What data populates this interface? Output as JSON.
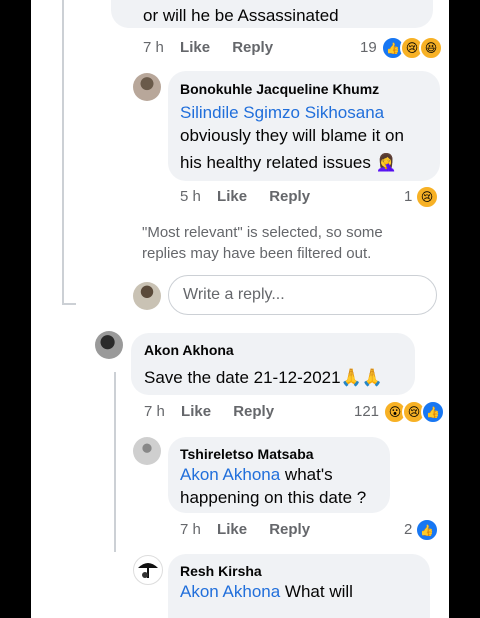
{
  "top_comment": {
    "partial_text": "or will he be Assassinated",
    "time": "7 h",
    "like_label": "Like",
    "reply_label": "Reply",
    "reaction_count": "19",
    "reactions": [
      "like-icon",
      "sad-icon",
      "haha-icon"
    ]
  },
  "reply1": {
    "author": "Bonokuhle Jacqueline Khumz",
    "mention": "Silindile Sgimzo Sikhosana",
    "line1": "obviously they will blame it on",
    "line2": "his healthy related issues",
    "emoji": "🤦‍♀️",
    "time": "5 h",
    "like_label": "Like",
    "reply_label": "Reply",
    "reaction_count": "1",
    "reactions": [
      "sad-icon"
    ]
  },
  "notice": {
    "line1": "\"Most relevant\" is selected, so some",
    "line2": "replies may have been filtered out."
  },
  "reply_box": {
    "placeholder": "Write a reply..."
  },
  "comment2": {
    "author": "Akon Akhona",
    "text": "Save the date 21-12-2021",
    "emoji": "🙏🙏",
    "time": "7 h",
    "like_label": "Like",
    "reply_label": "Reply",
    "reaction_count": "121",
    "reactions": [
      "wow-icon",
      "sad-icon",
      "like-icon"
    ]
  },
  "reply2": {
    "author": "Tshireletso Matsaba",
    "mention": "Akon Akhona",
    "line1_rest": " what's",
    "line2": "happening on this date ?",
    "time": "7 h",
    "like_label": "Like",
    "reply_label": "Reply",
    "reaction_count": "2",
    "reactions": [
      "like-icon"
    ]
  },
  "reply3": {
    "author": "Resh Kirsha",
    "mention": "Akon Akhona",
    "line1_rest": " What will"
  },
  "colors": {
    "mention": "#216fdb",
    "bubble": "#f0f2f5",
    "meta": "#65676b",
    "like_blue": "#1877f2",
    "emoji_yellow": "#f7b125"
  }
}
